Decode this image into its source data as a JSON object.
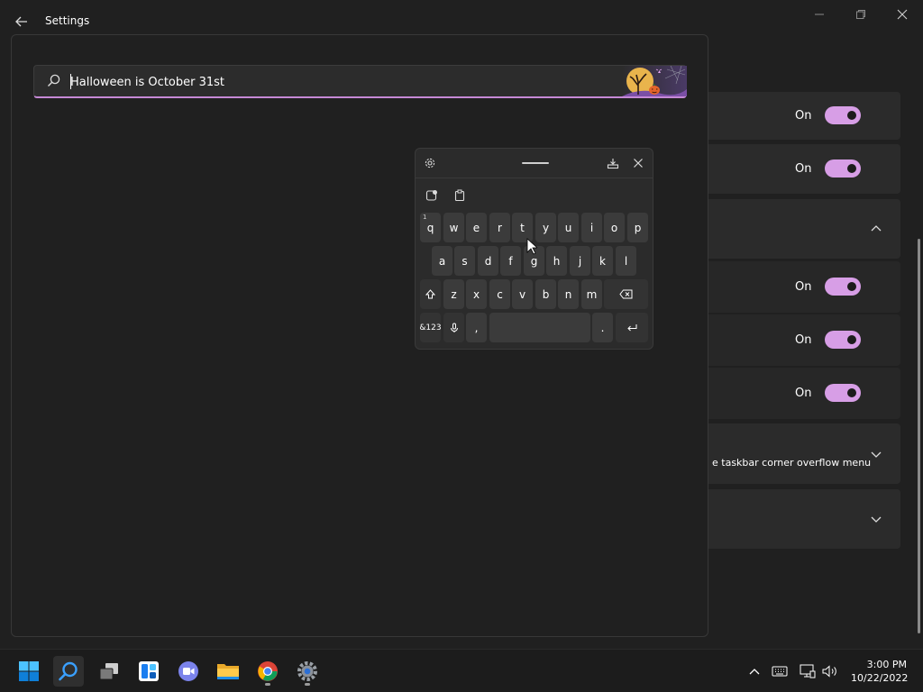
{
  "window": {
    "title": "Settings",
    "controls": [
      "minimize",
      "restore",
      "close"
    ]
  },
  "search": {
    "value": "Halloween is October 31st",
    "placeholder": ""
  },
  "background_rows": [
    {
      "state": "On",
      "toggle": true
    },
    {
      "state": "On",
      "toggle": true
    },
    {
      "expand": "up"
    },
    {
      "state": "On",
      "toggle": true
    },
    {
      "state": "On",
      "toggle": true
    },
    {
      "state": "On",
      "toggle": true
    },
    {
      "text": "e taskbar corner overflow menu",
      "expand": "down"
    },
    {
      "expand": "down"
    }
  ],
  "keyboard": {
    "row1": [
      {
        "k": "q",
        "hint": "1"
      },
      {
        "k": "w"
      },
      {
        "k": "e"
      },
      {
        "k": "r"
      },
      {
        "k": "t"
      },
      {
        "k": "y"
      },
      {
        "k": "u"
      },
      {
        "k": "i"
      },
      {
        "k": "o"
      },
      {
        "k": "p"
      }
    ],
    "row2": [
      "a",
      "s",
      "d",
      "f",
      "g",
      "h",
      "j",
      "k",
      "l"
    ],
    "row3": [
      "z",
      "x",
      "c",
      "v",
      "b",
      "n",
      "m"
    ],
    "row4": {
      "symbols": "&123",
      "comma": ",",
      "period": "."
    }
  },
  "taskbar": {
    "apps": [
      "start",
      "search",
      "task-view",
      "widgets",
      "teams-chat",
      "file-explorer",
      "chrome",
      "settings"
    ],
    "active": "search"
  },
  "tray": {
    "time": "3:00 PM",
    "date": "10/22/2022"
  },
  "colors": {
    "accent": "#d79ee6",
    "background": "#202020",
    "card": "#2b2b2b"
  }
}
